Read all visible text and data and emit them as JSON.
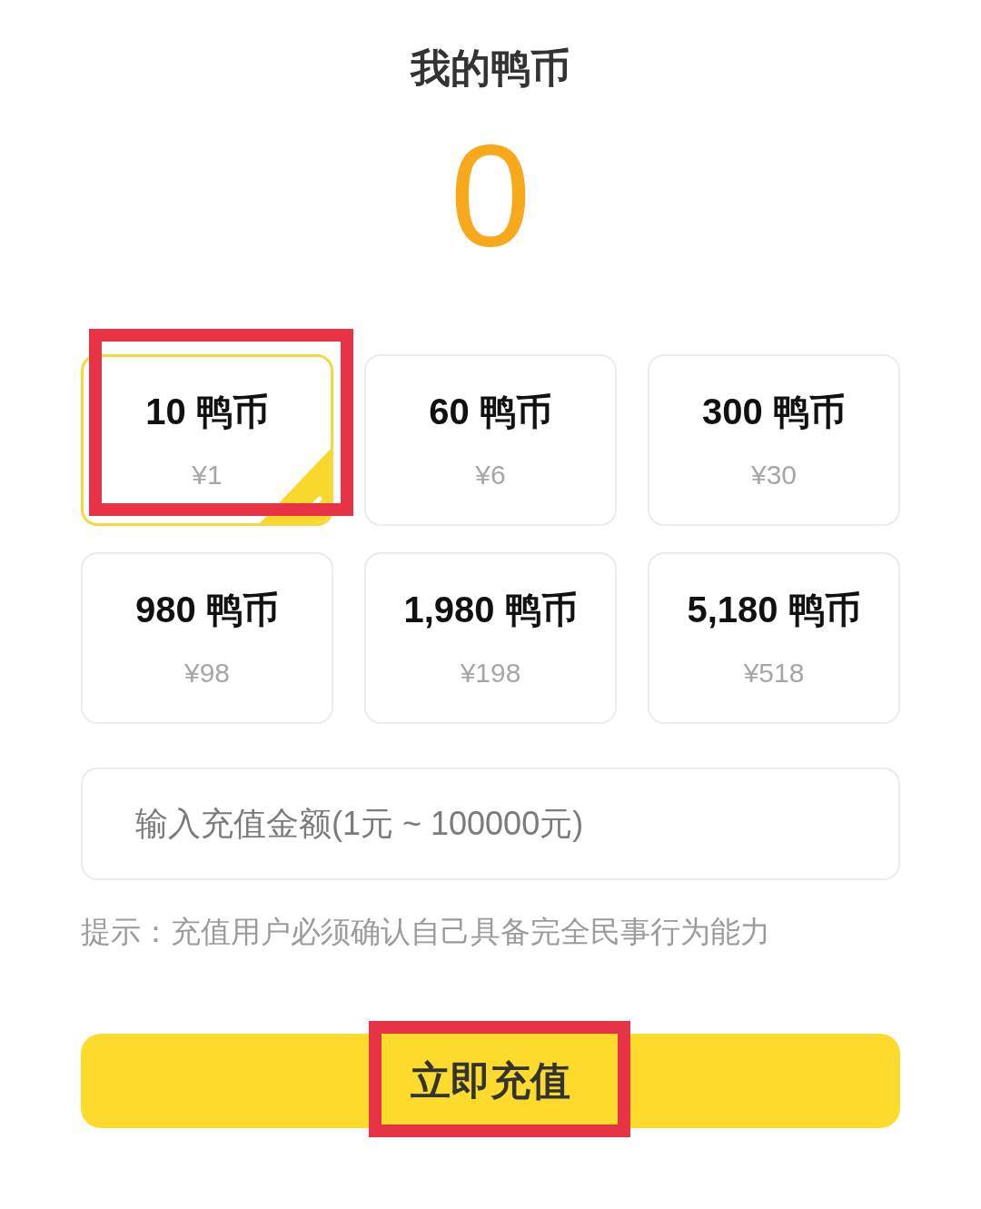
{
  "header": {
    "title": "我的鸭币",
    "balance": "0"
  },
  "packages": [
    {
      "coins": "10 鸭币",
      "price": "¥1",
      "selected": true,
      "highlighted": true
    },
    {
      "coins": "60 鸭币",
      "price": "¥6",
      "selected": false,
      "highlighted": false
    },
    {
      "coins": "300 鸭币",
      "price": "¥30",
      "selected": false,
      "highlighted": false
    },
    {
      "coins": "980 鸭币",
      "price": "¥98",
      "selected": false,
      "highlighted": false
    },
    {
      "coins": "1,980 鸭币",
      "price": "¥198",
      "selected": false,
      "highlighted": false
    },
    {
      "coins": "5,180 鸭币",
      "price": "¥518",
      "selected": false,
      "highlighted": false
    }
  ],
  "amount_field": {
    "placeholder": "输入充值金额(1元 ~ 100000元)"
  },
  "hint": "提示：充值用户必须确认自己具备完全民事行为能力",
  "submit_button": {
    "label": "立即充值",
    "highlighted": true
  }
}
